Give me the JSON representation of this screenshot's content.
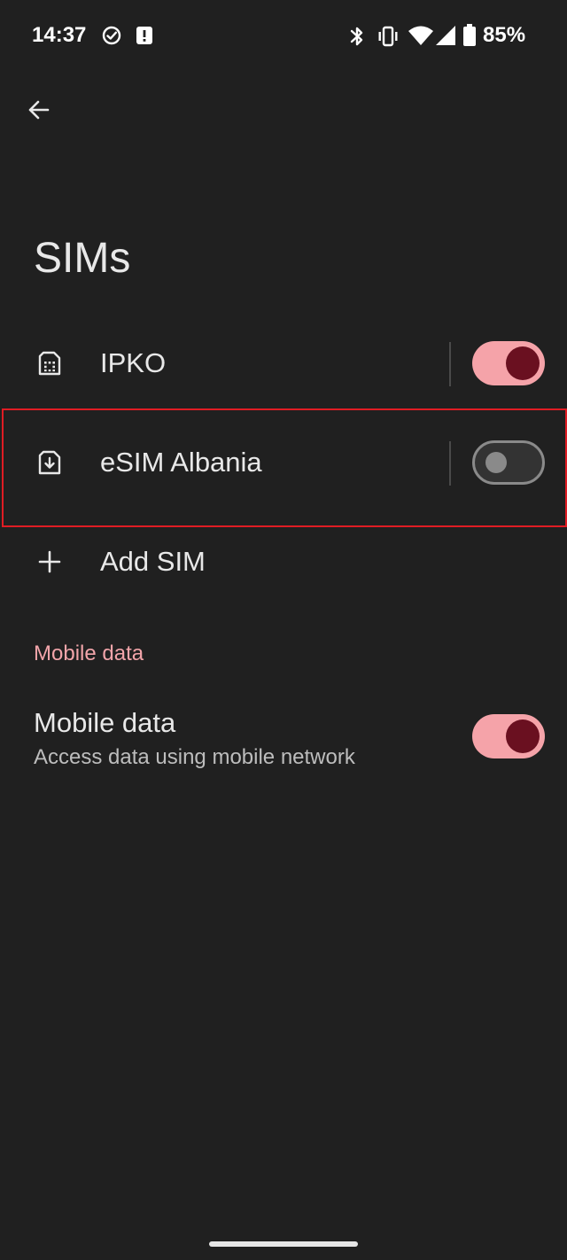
{
  "status_bar": {
    "time": "14:37",
    "battery": "85%",
    "icons": [
      "check-circle-icon",
      "alert-icon",
      "bluetooth-icon",
      "vibrate-icon",
      "wifi-icon",
      "signal-icon",
      "battery-icon"
    ]
  },
  "header": {
    "back_icon": "back-arrow-icon",
    "title": "SIMs"
  },
  "sims": [
    {
      "label": "IPKO",
      "icon": "sim-card-icon",
      "enabled": true
    },
    {
      "label": "eSIM Albania",
      "icon": "esim-download-icon",
      "enabled": false
    }
  ],
  "add_sim": {
    "label": "Add SIM",
    "icon": "plus-icon"
  },
  "mobile_data_section": {
    "header": "Mobile data",
    "title": "Mobile data",
    "subtitle": "Access data using mobile network",
    "enabled": true
  },
  "colors": {
    "background": "#202020",
    "accent": "#f5a3a9",
    "toggle_knob_on": "#6a1020",
    "highlight": "#e01c24"
  }
}
